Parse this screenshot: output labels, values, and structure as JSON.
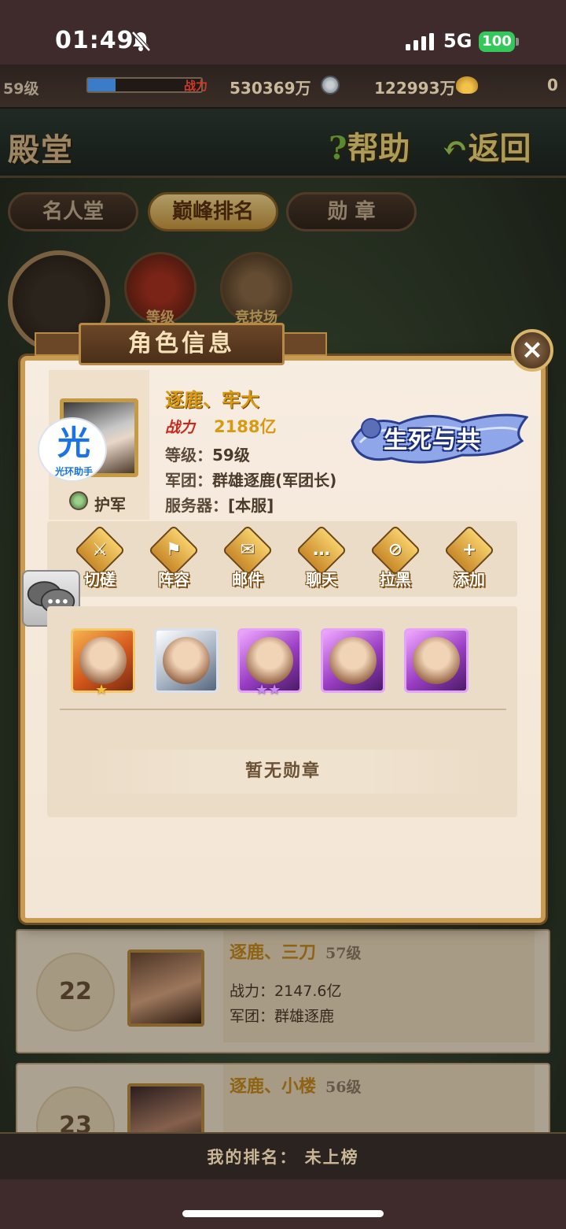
{
  "status_bar": {
    "time": "01:49",
    "network": "5G",
    "battery": "100"
  },
  "resources": {
    "level": "59级",
    "exp_fraction": 0.24,
    "power_tag": "战力",
    "power": "530369万",
    "coins": "122993万",
    "ingots": "0"
  },
  "header": {
    "title": "殿堂",
    "help_q": "?",
    "help": "帮助",
    "back": "返回"
  },
  "tabs": [
    {
      "label": "名人堂",
      "active": false
    },
    {
      "label": "巅峰排名",
      "active": true
    },
    {
      "label": "勋 章",
      "active": false
    }
  ],
  "sub_icons": [
    {
      "label": "等级"
    },
    {
      "label": "竞技场"
    }
  ],
  "modal": {
    "title": "角色信息",
    "close": "×",
    "player": {
      "name": "逐鹿、牢大",
      "power_tag": "战力",
      "power": "2188亿",
      "level_label": "等级：",
      "level": "59级",
      "legion_label": "军团：",
      "legion": "群雄逐鹿(军团长)",
      "server_label": "服务器：",
      "server": "[本服]",
      "title_badge": "护军",
      "bond_badge": "生死与共"
    },
    "watermark": {
      "char": "光",
      "text": "光环助手"
    },
    "actions": [
      {
        "label": "切磋",
        "icon": "crossed-swords-icon",
        "glyph": "⚔"
      },
      {
        "label": "阵容",
        "icon": "flag-icon",
        "glyph": "⚑"
      },
      {
        "label": "邮件",
        "icon": "mail-icon",
        "glyph": "✉"
      },
      {
        "label": "聊天",
        "icon": "chat-bubble-icon",
        "glyph": "…"
      },
      {
        "label": "拉黑",
        "icon": "block-icon",
        "glyph": "⊘"
      },
      {
        "label": "添加",
        "icon": "add-friend-icon",
        "glyph": "+"
      }
    ],
    "heroes": [
      {
        "rarity": "orange",
        "stars": "★"
      },
      {
        "rarity": "silver",
        "stars": ""
      },
      {
        "rarity": "purple",
        "stars": "★★"
      },
      {
        "rarity": "purple",
        "stars": ""
      },
      {
        "rarity": "purple",
        "stars": ""
      }
    ],
    "no_medal": "暂无勋章"
  },
  "ranking_rows": [
    {
      "rank": "22",
      "name": "逐鹿、三刀",
      "level": "57级",
      "power_label": "战力：",
      "power": "2147.6亿",
      "legion_label": "军团：",
      "legion": "群雄逐鹿"
    },
    {
      "rank": "23",
      "name": "逐鹿、小楼",
      "level": "56级"
    }
  ],
  "footer": {
    "my_rank": "我的排名： 未上榜"
  },
  "colors": {
    "accent_gold": "#d79a12",
    "power_red": "#c8281b",
    "battery_green": "#34c759"
  }
}
